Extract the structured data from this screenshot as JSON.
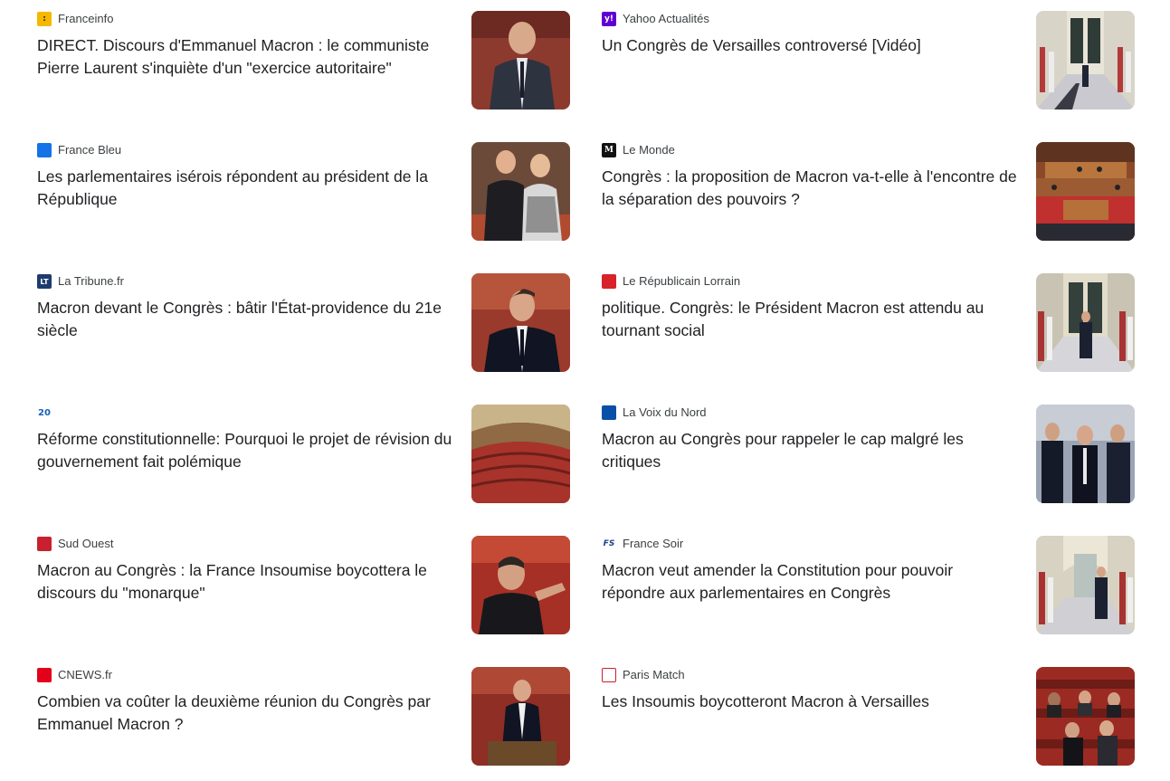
{
  "articles": [
    {
      "source": "Franceinfo",
      "headline": "DIRECT. Discours d'Emmanuel Macron : le communiste Pierre Laurent s'inquiète d'un \"exercice autoritaire\"",
      "logo_icon": "franceinfo-logo-icon",
      "logo_color": "#f5b800",
      "logo_text": ":"
    },
    {
      "source": "Yahoo Actualités",
      "headline": "Un Congrès de Versailles controversé [Vidéo]",
      "logo_icon": "yahoo-logo-icon",
      "logo_color": "#6001d2",
      "logo_text": "y!"
    },
    {
      "source": "France Bleu",
      "headline": "Les parlementaires isérois répondent au président de la République",
      "logo_icon": "france-bleu-logo-icon",
      "logo_color": "#1473e6",
      "logo_text": ""
    },
    {
      "source": "Le Monde",
      "headline": "Congrès : la proposition de Macron va-t-elle à l'encontre de la séparation des pouvoirs ?",
      "logo_icon": "le-monde-logo-icon",
      "logo_color": "#111111",
      "logo_text": "M"
    },
    {
      "source": "La Tribune.fr",
      "headline": "Macron devant le Congrès : bâtir l'État-providence du 21e siècle",
      "logo_icon": "la-tribune-logo-icon",
      "logo_color": "#1d3b6e",
      "logo_text": "LT"
    },
    {
      "source": "Le Républicain Lorrain",
      "headline": "politique. Congrès: le Président Macron est attendu au tournant social",
      "logo_icon": "republicain-lorrain-logo-icon",
      "logo_color": "#d8232a",
      "logo_text": ""
    },
    {
      "source": "",
      "headline": "Réforme constitutionnelle: Pourquoi le projet de révision du gouvernement fait polémique",
      "logo_icon": "20-minutes-logo-icon",
      "logo_color": "#ffffff",
      "logo_text": "20"
    },
    {
      "source": "La Voix du Nord",
      "headline": "Macron au Congrès pour rappeler le cap malgré les critiques",
      "logo_icon": "voix-du-nord-logo-icon",
      "logo_color": "#0a4fa6",
      "logo_text": ""
    },
    {
      "source": "Sud Ouest",
      "headline": "Macron au Congrès : la France Insoumise boycottera le discours du \"monarque\"",
      "logo_icon": "sud-ouest-logo-icon",
      "logo_color": "#c8202e",
      "logo_text": ""
    },
    {
      "source": "France Soir",
      "headline": "Macron veut amender la Constitution pour pouvoir répondre aux parlementaires en Congrès",
      "logo_icon": "france-soir-logo-icon",
      "logo_color": "#ffffff",
      "logo_text": "FS"
    },
    {
      "source": "CNEWS.fr",
      "headline": "Combien va coûter la deuxième réunion du Congrès par Emmanuel Macron ?",
      "logo_icon": "cnews-logo-icon",
      "logo_color": "#e3001b",
      "logo_text": ""
    },
    {
      "source": "Paris Match",
      "headline": "Les Insoumis boycotteront Macron à Versailles",
      "logo_icon": "paris-match-logo-icon",
      "logo_color": "#ffffff",
      "logo_text": ""
    }
  ]
}
